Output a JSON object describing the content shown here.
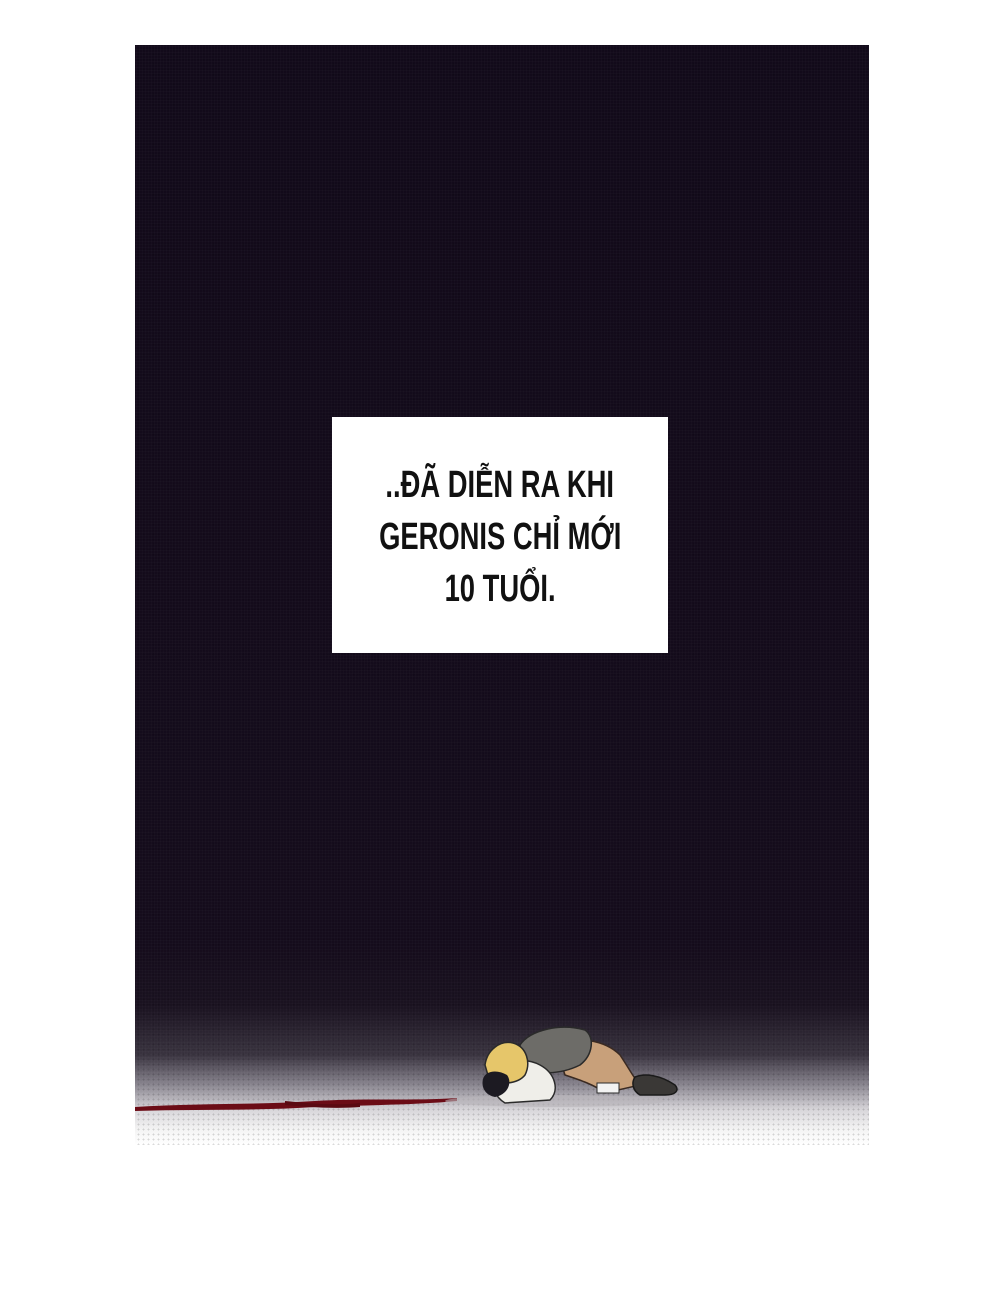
{
  "caption": {
    "lines": [
      "..ĐÃ DIỄN RA KHI",
      "GERONIS CHỈ MỚI",
      "10 TUỔI."
    ]
  },
  "colors": {
    "background_dark": "#120a1a",
    "caption_background": "#ffffff",
    "caption_text": "#111111",
    "blood": "#6b0c16"
  }
}
